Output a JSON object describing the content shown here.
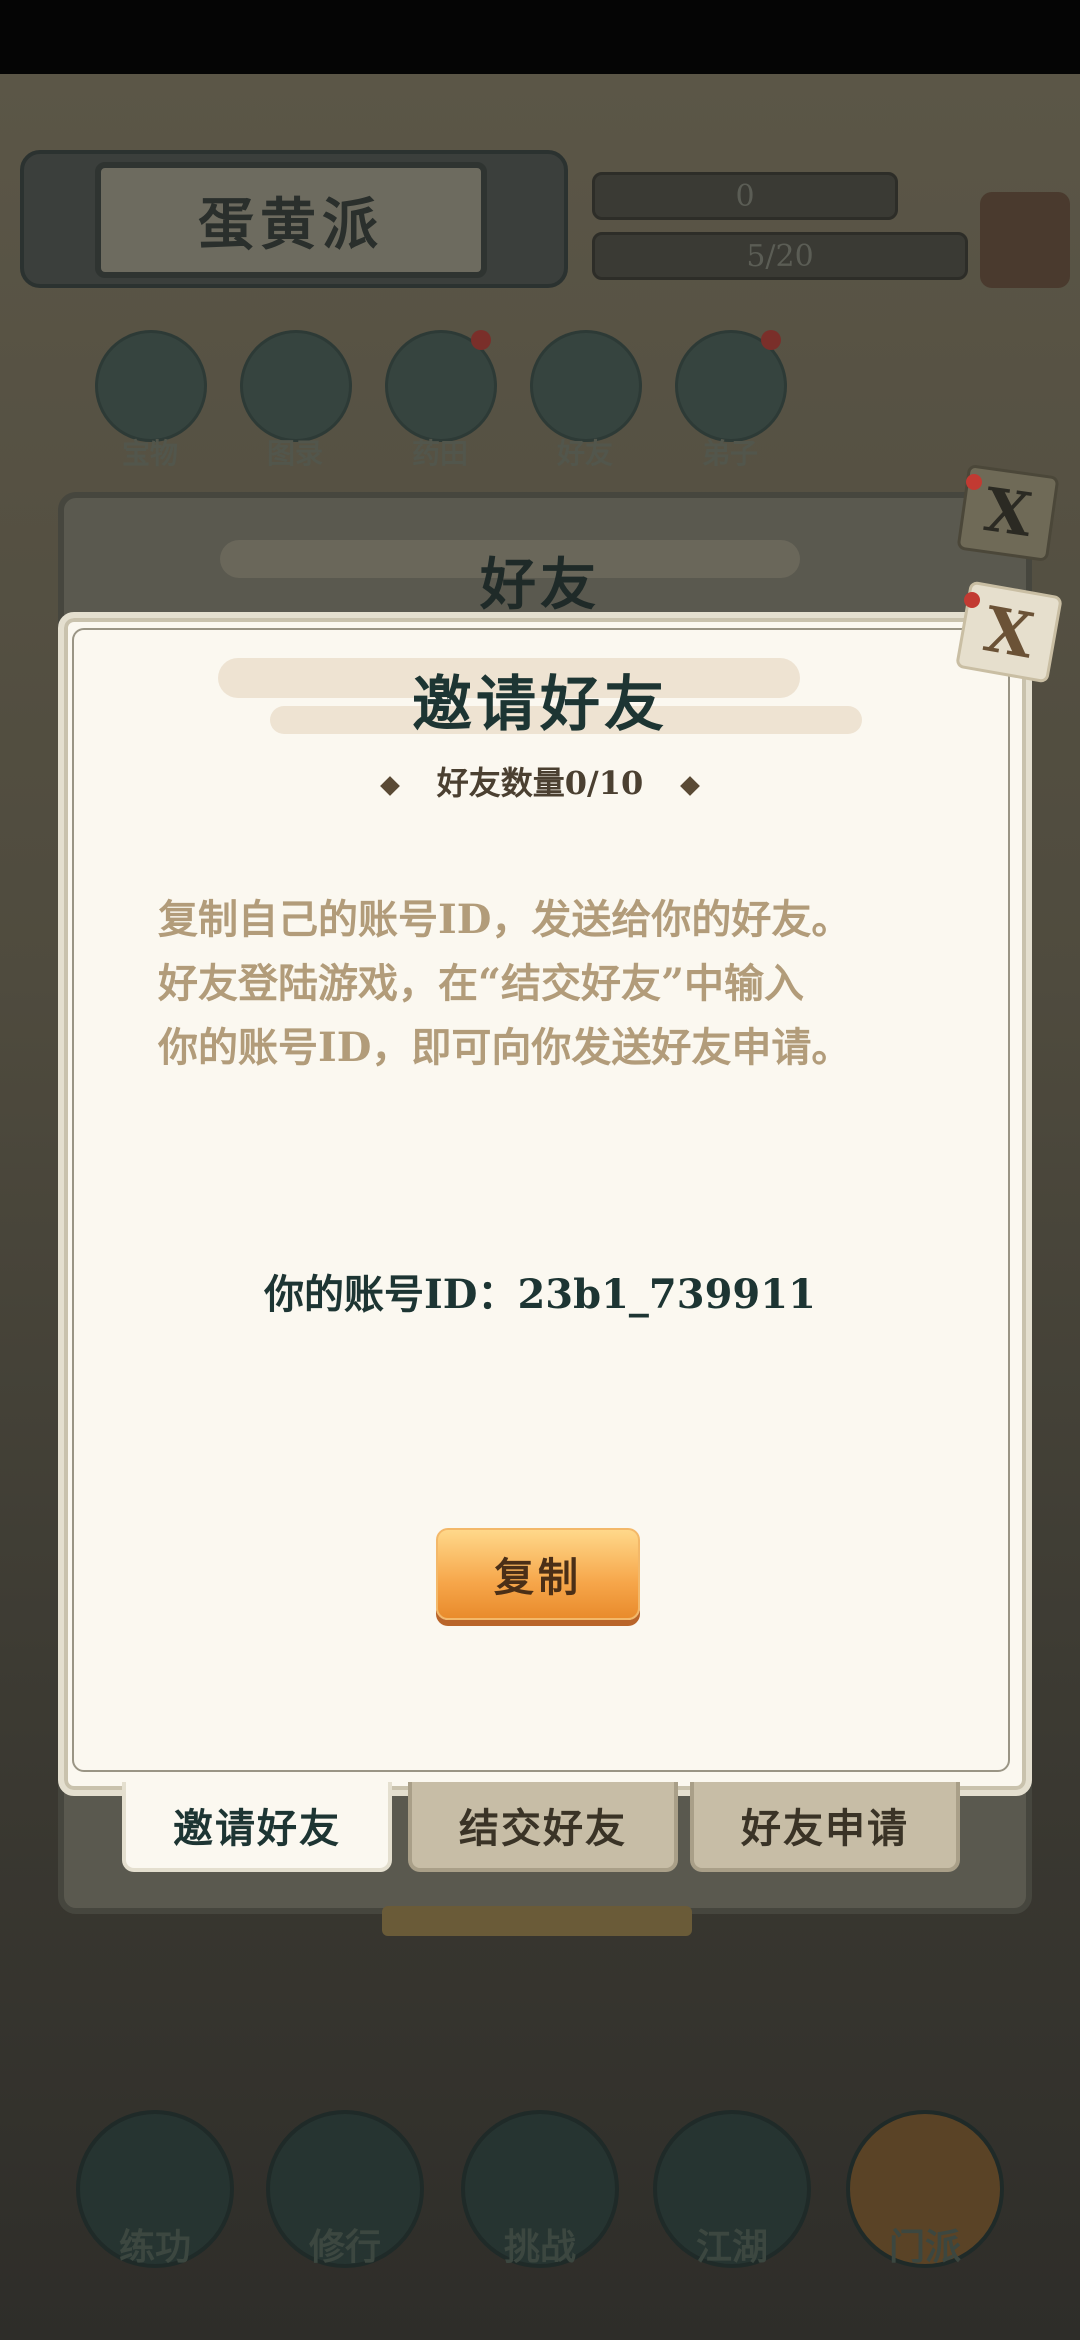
{
  "background": {
    "sect_name": "蛋黄派",
    "currency_value": "0",
    "capacity": "5/20",
    "icons": [
      {
        "label": "宝物",
        "icon": "treasure-icon",
        "badge": false
      },
      {
        "label": "图录",
        "icon": "book-icon",
        "badge": false
      },
      {
        "label": "药田",
        "icon": "herb-field-icon",
        "badge": true
      },
      {
        "label": "好友",
        "icon": "friends-icon",
        "badge": false
      },
      {
        "label": "弟子",
        "icon": "disciple-icon",
        "badge": true
      }
    ],
    "bottom_nav": [
      {
        "label": "练功",
        "icon": "training-icon"
      },
      {
        "label": "修行",
        "icon": "cultivation-icon"
      },
      {
        "label": "挑战",
        "icon": "swords-icon"
      },
      {
        "label": "江湖",
        "icon": "jianghu-icon"
      },
      {
        "label": "门派",
        "icon": "sect-gate-icon"
      }
    ]
  },
  "back_modal": {
    "title": "好友"
  },
  "modal": {
    "title": "邀请好友",
    "friend_count": "好友数量0/10",
    "description": [
      "复制自己的账号ID，发送给你的好友。",
      "好友登陆游戏，在“结交好友”中输入",
      "你的账号ID，即可向你发送好友申请。"
    ],
    "account_label": "你的账号ID：23b1_739911",
    "copy_button": "复制",
    "close_glyph": "X"
  },
  "tabs": [
    {
      "label": "邀请好友",
      "active": true
    },
    {
      "label": "结交好友",
      "active": false
    },
    {
      "label": "好友申请",
      "active": false
    }
  ],
  "colors": {
    "panel": "#fbf8f0",
    "title": "#1d3533",
    "description": "#b29c7a",
    "button": "#f6a64a"
  }
}
